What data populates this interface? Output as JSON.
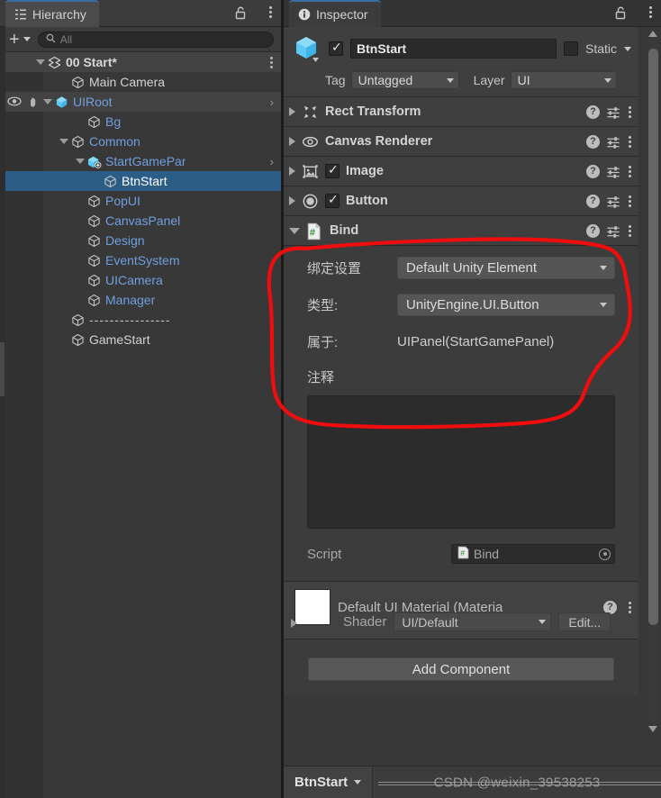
{
  "hierarchy": {
    "tab_label": "Hierarchy",
    "tab_icon": "hierarchy-icon",
    "toolbar": {
      "add_label": "+",
      "search_placeholder": "All",
      "search_value": ""
    },
    "scene": {
      "label": "00 Start*",
      "icon": "unity-scene-icon"
    },
    "items": [
      {
        "label": "Main Camera",
        "depth": 2,
        "icon": "gameobject-icon",
        "color": "white",
        "foldout": "none",
        "prefab_arrow": false
      },
      {
        "label": "UIRoot",
        "depth": 1,
        "icon": "prefab-icon",
        "color": "blue",
        "foldout": "open",
        "prefab_arrow": true,
        "gutter_icons": [
          "eye-icon",
          "hand-icon"
        ]
      },
      {
        "label": "Bg",
        "depth": 3,
        "icon": "gameobject-icon",
        "color": "blue",
        "foldout": "none",
        "prefab_arrow": false
      },
      {
        "label": "Common",
        "depth": 2,
        "icon": "gameobject-icon",
        "color": "blue",
        "foldout": "open",
        "prefab_arrow": false
      },
      {
        "label": "StartGamePar",
        "depth": 3,
        "icon": "prefab-variant-icon",
        "color": "blue",
        "foldout": "open",
        "prefab_arrow": true
      },
      {
        "label": "BtnStart",
        "depth": 4,
        "icon": "gameobject-icon",
        "color": "white",
        "foldout": "none",
        "prefab_arrow": false,
        "selected": true
      },
      {
        "label": "PopUI",
        "depth": 3,
        "icon": "gameobject-icon",
        "color": "blue",
        "foldout": "none",
        "prefab_arrow": false
      },
      {
        "label": "CanvasPanel",
        "depth": 3,
        "icon": "gameobject-icon",
        "color": "blue",
        "foldout": "none",
        "prefab_arrow": false
      },
      {
        "label": "Design",
        "depth": 3,
        "icon": "gameobject-icon",
        "color": "blue",
        "foldout": "none",
        "prefab_arrow": false
      },
      {
        "label": "EventSystem",
        "depth": 3,
        "icon": "gameobject-icon",
        "color": "blue",
        "foldout": "none",
        "prefab_arrow": false
      },
      {
        "label": "UICamera",
        "depth": 3,
        "icon": "gameobject-icon",
        "color": "blue",
        "foldout": "none",
        "prefab_arrow": false
      },
      {
        "label": "Manager",
        "depth": 3,
        "icon": "gameobject-icon",
        "color": "blue",
        "foldout": "none",
        "prefab_arrow": false
      },
      {
        "label": "----------------",
        "depth": 2,
        "icon": "gameobject-icon",
        "color": "white",
        "foldout": "none",
        "prefab_arrow": false
      },
      {
        "label": "GameStart",
        "depth": 2,
        "icon": "gameobject-icon",
        "color": "white",
        "foldout": "none",
        "prefab_arrow": false
      }
    ]
  },
  "inspector": {
    "tab_label": "Inspector",
    "tab_icon": "info-icon",
    "lock_icon": "lock-open-icon",
    "menu_icon": "kebab-menu-icon",
    "identity": {
      "enabled": true,
      "name": "BtnStart",
      "static_label": "Static",
      "static_checked": false,
      "tag_label": "Tag",
      "tag_value": "Untagged",
      "layer_label": "Layer",
      "layer_value": "UI"
    },
    "components": [
      {
        "name": "Rect Transform",
        "icon": "rect-transform-icon",
        "expanded": false,
        "has_enable_checkbox": false
      },
      {
        "name": "Canvas Renderer",
        "icon": "canvas-renderer-icon",
        "expanded": false,
        "has_enable_checkbox": false
      },
      {
        "name": "Image",
        "icon": "image-icon",
        "expanded": false,
        "has_enable_checkbox": true,
        "enabled": true
      },
      {
        "name": "Button",
        "icon": "button-icon",
        "expanded": false,
        "has_enable_checkbox": true,
        "enabled": true
      },
      {
        "name": "Bind",
        "icon": "csharp-script-icon",
        "expanded": true,
        "has_enable_checkbox": false
      }
    ],
    "bind": {
      "binding_settings_label": "绑定设置",
      "binding_settings_value": "Default Unity Element",
      "type_label": "类型:",
      "type_value": "UnityEngine.UI.Button",
      "belongs_label": "属于:",
      "belongs_value": "UIPanel(StartGamePanel)",
      "comment_label": "注释",
      "comment_value": "",
      "script_label": "Script",
      "script_value": "Bind"
    },
    "material": {
      "title": "Default UI Material (Materia",
      "shader_label": "Shader",
      "shader_value": "UI/Default",
      "edit_label": "Edit..."
    },
    "add_component_label": "Add Component"
  },
  "statusbar": {
    "breadcrumb": "BtnStart",
    "watermark": "CSDN @weixin_39538253"
  },
  "annotation": {
    "type": "hand-drawn-ellipse",
    "color": "#f00d0d",
    "stroke_width": 4
  },
  "colors": {
    "panel_bg": "#383838",
    "header_bg": "#3c3c3c",
    "selection_blue": "#2c5d87",
    "prefab_text_blue": "#6f9fe0",
    "accent_tab_blue": "#3a6ea5",
    "annotation_red": "#f00d0d"
  }
}
